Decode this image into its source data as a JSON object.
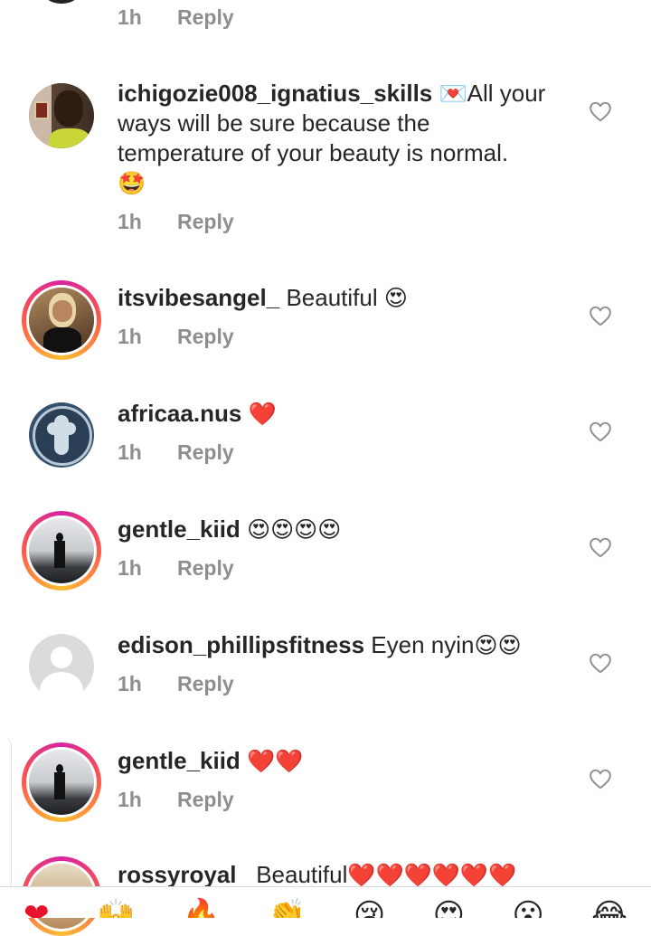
{
  "top": {
    "time": "1h",
    "reply": "Reply"
  },
  "comments": [
    {
      "username": "ichigozie008_ignatius_skills",
      "emoji_prefix": "💌",
      "text": "All your ways will be sure because the temperature of your beauty is normal.",
      "emoji_suffix": "🤩",
      "time": "1h",
      "reply": "Reply"
    },
    {
      "username": "itsvibesangel_",
      "text": "Beautiful",
      "emoji_suffix": "😍",
      "time": "1h",
      "reply": "Reply"
    },
    {
      "username": "africaa.nus",
      "text": "",
      "emoji_suffix": "❤️",
      "time": "1h",
      "reply": "Reply"
    },
    {
      "username": "gentle_kiid",
      "text": "",
      "emoji_suffix": "😍😍😍😍",
      "time": "1h",
      "reply": "Reply"
    },
    {
      "username": "edison_phillipsfitness",
      "text": "Eyen nyin",
      "emoji_suffix": "😍😍",
      "time": "1h",
      "reply": "Reply"
    },
    {
      "username": "gentle_kiid",
      "text": "",
      "emoji_suffix": "❤️❤️",
      "time": "1h",
      "reply": "Reply"
    },
    {
      "username": "rossyroyal",
      "text": "Beautiful",
      "emoji_suffix": "❤️❤️❤️❤️❤️❤️"
    }
  ],
  "icons": {
    "like": "heart-outline-icon"
  },
  "colors": {
    "meta": "#8e8e8e",
    "text": "#262626",
    "heart": "#e8132b"
  }
}
